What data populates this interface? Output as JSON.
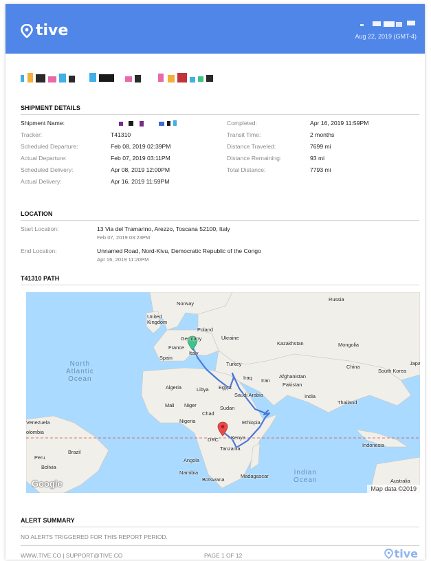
{
  "brand": {
    "name": "tive",
    "accent": "#4f86e8",
    "footer_logo_color": "#8fb3f0"
  },
  "header": {
    "date": "Aug 22, 2019 (GMT-4)"
  },
  "shipment_details": {
    "title": "SHIPMENT DETAILS",
    "left": [
      {
        "label": "Shipment Name:",
        "value": ""
      },
      {
        "label": "Tracker:",
        "value": "T41310"
      },
      {
        "label": "Scheduled Departure:",
        "value": "Feb 08, 2019 02:39PM"
      },
      {
        "label": "Actual Departure:",
        "value": "Feb 07, 2019 03:11PM"
      },
      {
        "label": "Scheduled Delivery:",
        "value": "Apr 08, 2019 12:00PM"
      },
      {
        "label": "Actual Delivery:",
        "value": "Apr 16, 2019 11:59PM"
      }
    ],
    "right": [
      {
        "label": "Completed:",
        "value": "Apr 16, 2019 11:59PM"
      },
      {
        "label": "Transit Time:",
        "value": "2 months"
      },
      {
        "label": "Distance Traveled:",
        "value": "7699 mi"
      },
      {
        "label": "Distance Remaining:",
        "value": "93 mi"
      },
      {
        "label": "Total Distance:",
        "value": "7793 mi"
      }
    ]
  },
  "location": {
    "title": "LOCATION",
    "start": {
      "label": "Start Location:",
      "value": "13 Via del Tramarino, Arezzo, Toscana 52100, Italy",
      "time": "Feb 07, 2019 03:23PM"
    },
    "end": {
      "label": "End Location:",
      "value": "Unnamed Road, Nord-Kivu, Democratic Republic of the Congo",
      "time": "Apr 16, 2019 11:20PM"
    }
  },
  "path": {
    "title": "T41310 PATH",
    "map_labels": {
      "norway": "Norway",
      "uk": "United\nKingdom",
      "russia": "Russia",
      "poland": "Poland",
      "germany": "Germany",
      "ukraine": "Ukraine",
      "kazakhstan": "Kazakhstan",
      "mongolia": "Mongolia",
      "france": "France",
      "italy": "Italy",
      "spain": "Spain",
      "turkey": "Turkey",
      "china": "China",
      "south_korea": "South Korea",
      "japan": "Japan",
      "iraq": "Iraq",
      "iran": "Iran",
      "afghanistan": "Afghanistan",
      "pakistan": "Pakistan",
      "algeria": "Algeria",
      "libya": "Libya",
      "egypt": "Egypt",
      "saudi_arabia": "Saudi Arabia",
      "india": "India",
      "thailand": "Thailand",
      "mali": "Mali",
      "niger": "Niger",
      "sudan": "Sudan",
      "chad": "Chad",
      "nigeria": "Nigeria",
      "ethiopia": "Ethiopia",
      "venezuela": "Venezuela",
      "colombia": "olombia",
      "drc": "DRC",
      "kenya": "Kenya",
      "tanzania": "Tanzania",
      "indonesia": "Indonesia",
      "brazil": "Brazil",
      "peru": "Peru",
      "bolivia": "Bolivia",
      "angola": "Angola",
      "namibia": "Namibia",
      "botswana": "Botswana",
      "madagascar": "Madagascar",
      "australia": "Australia",
      "north_atlantic": "North\nAtlantic\nOcean",
      "indian_ocean": "Indian\nOcean"
    },
    "google": "Google",
    "attribution": "Map data ©2019",
    "start_marker_color": "#3ec48a",
    "end_marker_color": "#e84a4a",
    "route_color": "#4a78d8"
  },
  "alerts": {
    "title": "ALERT SUMMARY",
    "text": "NO ALERTS TRIGGERED FOR THIS REPORT PERIOD."
  },
  "footer": {
    "links": "WWW.TIVE.CO | SUPPORT@TIVE.CO",
    "page": "PAGE 1 OF 12"
  }
}
